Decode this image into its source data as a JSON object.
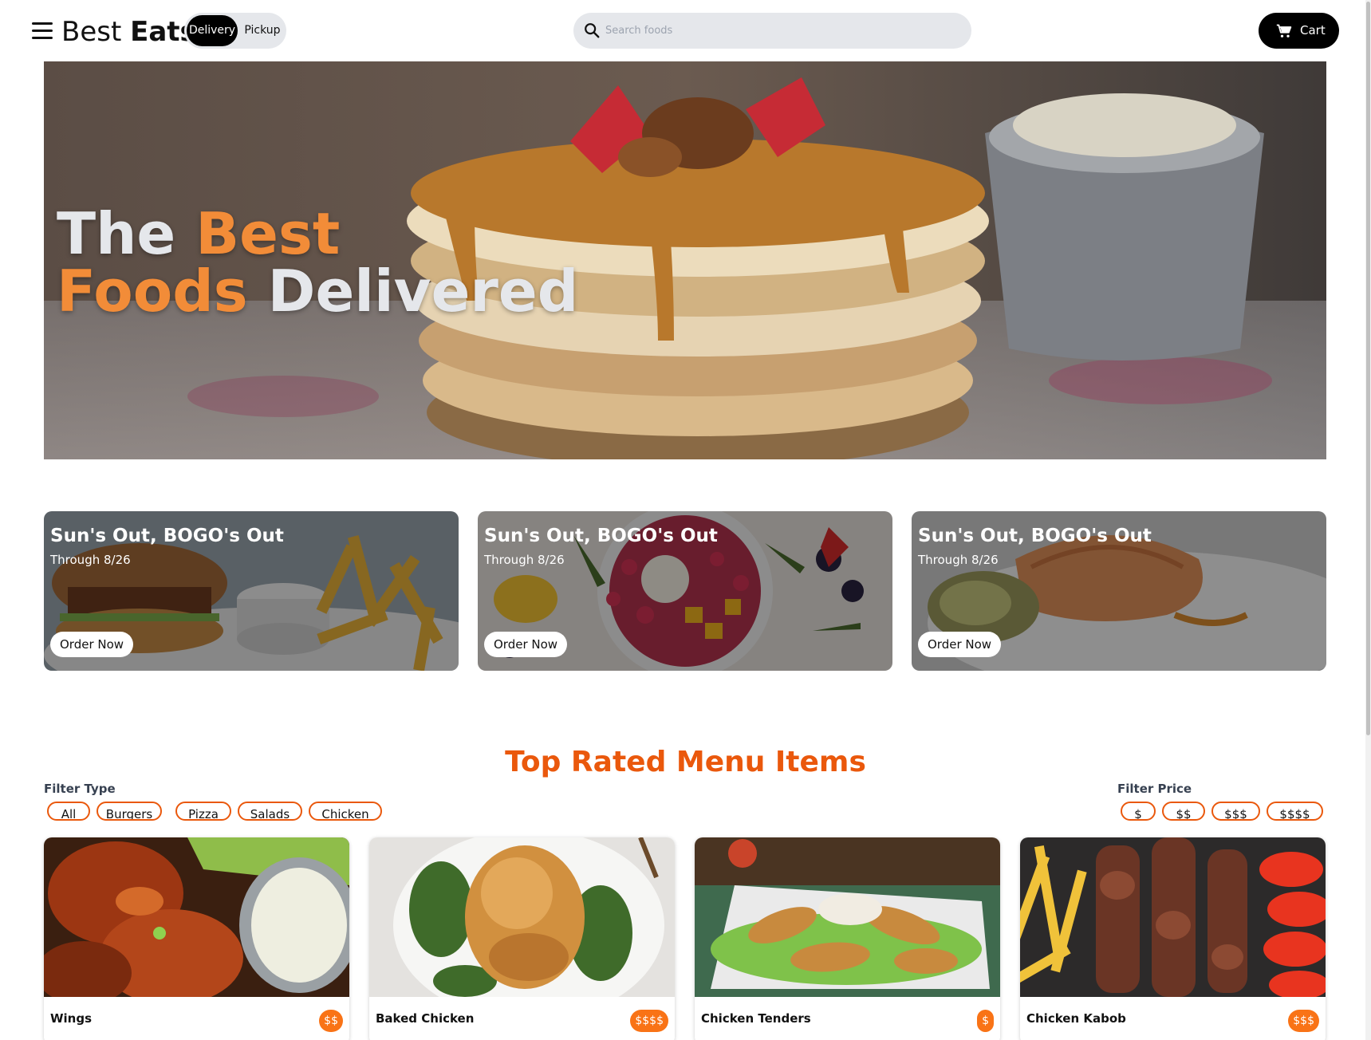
{
  "header": {
    "brand_light": "Best",
    "brand_bold": "Eats",
    "mode_options": [
      "Delivery",
      "Pickup"
    ],
    "selected_mode": "Delivery",
    "search": {
      "placeholder": "Search foods",
      "value": ""
    },
    "cart_label": "Cart"
  },
  "hero": {
    "line1_white": "The",
    "line1_orange": "Best",
    "line2_orange": "Foods",
    "line2_white": "Delivered"
  },
  "promos": [
    {
      "title": "Sun's Out, BOGO's Out",
      "subtitle": "Through 8/26",
      "button": "Order Now"
    },
    {
      "title": "Sun's Out, BOGO's Out",
      "subtitle": "Through 8/26",
      "button": "Order Now"
    },
    {
      "title": "Sun's Out, BOGO's Out",
      "subtitle": "Through 8/26",
      "button": "Order Now"
    }
  ],
  "menu": {
    "title": "Top Rated Menu Items",
    "filter_type": {
      "label": "Filter Type",
      "options": [
        "All",
        "Burgers",
        "Pizza",
        "Salads",
        "Chicken"
      ]
    },
    "filter_price": {
      "label": "Filter Price",
      "options": [
        "$",
        "$$",
        "$$$",
        "$$$$"
      ]
    },
    "items": [
      {
        "name": "Wings",
        "price": "$$"
      },
      {
        "name": "Baked Chicken",
        "price": "$$$$"
      },
      {
        "name": "Chicken Tenders",
        "price": "$"
      },
      {
        "name": "Chicken Kabob",
        "price": "$$$"
      }
    ]
  },
  "colors": {
    "accent_orange": "#ea580c",
    "hero_orange": "#f28c38",
    "price_badge": "#f97316",
    "dark": "#000000",
    "pill_gray": "#e5e7eb"
  }
}
